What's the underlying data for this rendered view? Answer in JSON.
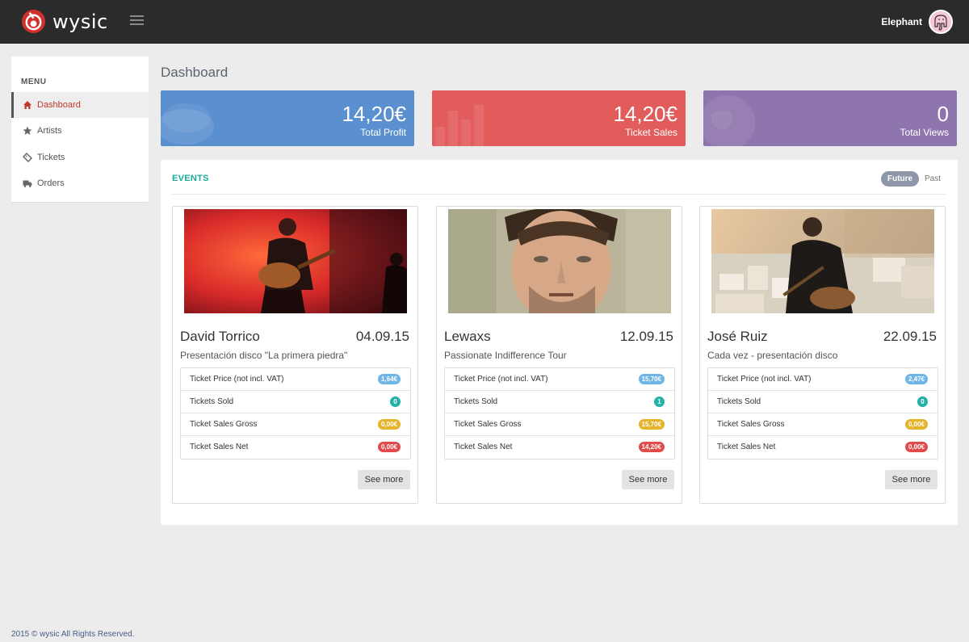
{
  "app": {
    "name": "wysic"
  },
  "user": {
    "name": "Elephant"
  },
  "sidebar": {
    "title": "MENU",
    "items": [
      {
        "label": "Dashboard",
        "icon": "home-icon",
        "active": true
      },
      {
        "label": "Artists",
        "icon": "star-icon"
      },
      {
        "label": "Tickets",
        "icon": "ticket-icon"
      },
      {
        "label": "Orders",
        "icon": "truck-icon"
      }
    ]
  },
  "page": {
    "title": "Dashboard"
  },
  "tiles": [
    {
      "value": "14,20€",
      "label": "Total Profit",
      "color": "#5a8fd0"
    },
    {
      "value": "14,20€",
      "label": "Ticket Sales",
      "color": "#e25c5c"
    },
    {
      "value": "0",
      "label": "Total Views",
      "color": "#8f75ad"
    }
  ],
  "events": {
    "title": "EVENTS",
    "tabs": {
      "future": "Future",
      "past": "Past",
      "selected": "Future"
    },
    "stat_labels": [
      "Ticket Price (not incl. VAT)",
      "Tickets Sold",
      "Ticket Sales Gross",
      "Ticket Sales Net"
    ],
    "see_more": "See more",
    "cards": [
      {
        "name": "David Torrico",
        "date": "04.09.15",
        "subtitle": "Presentación disco \"La primera piedra\"",
        "price": "1,64€",
        "sold": "0",
        "gross": "0,00€",
        "net": "0,00€"
      },
      {
        "name": "Lewaxs",
        "date": "12.09.15",
        "subtitle": "Passionate Indifference Tour",
        "price": "15,70€",
        "sold": "1",
        "gross": "15,70€",
        "net": "14,20€"
      },
      {
        "name": "José Ruiz",
        "date": "22.09.15",
        "subtitle": "Cada vez - presentación disco",
        "price": "2,47€",
        "sold": "0",
        "gross": "0,00€",
        "net": "0,00€"
      }
    ]
  },
  "footer": {
    "text": "2015 © wysic All Rights Reserved."
  }
}
